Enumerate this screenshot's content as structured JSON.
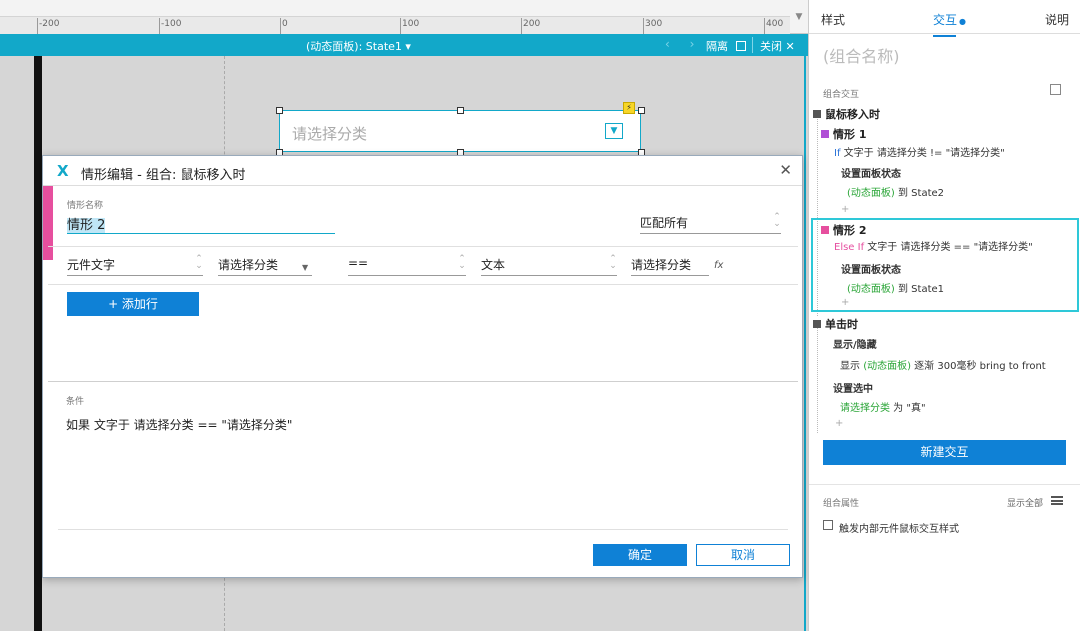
{
  "ruler": {
    "ticks": [
      "-200",
      "-100",
      "0",
      "100",
      "200",
      "300",
      "400"
    ]
  },
  "panel_bar": {
    "state_selector": "(动态面板): State1 ▾",
    "isolate_label": "隔离",
    "close_label": "关闭 ✕",
    "nav_arrows": "‹ ›"
  },
  "canvas_widget": {
    "placeholder": "请选择分类",
    "arrow_icon": "chevron-down-icon"
  },
  "dialog": {
    "logo": "X",
    "title": "情形编辑  -  组合: 鼠标移入时",
    "close_icon": "✕",
    "case_name_label": "情形名称",
    "case_name_value": "情形 2",
    "match_select": "匹配所有",
    "condition_row": {
      "field1": "元件文字",
      "field2": "请选择分类",
      "operator": "==",
      "field4": "文本",
      "field5": "请选择分类",
      "fx": "fx"
    },
    "add_row_button": "+ 添加行",
    "condition_label": "条件",
    "condition_text": "如果 文字于 请选择分类 == \"请选择分类\"",
    "ok_button": "确定",
    "cancel_button": "取消"
  },
  "right_panel": {
    "tabs": [
      "样式",
      "交互",
      "说明"
    ],
    "active_tab_dot": "●",
    "group_name_placeholder": "(组合名称)",
    "group_interactions_label": "组合交互",
    "event_mouse_enter": "鼠标移入时",
    "case1": {
      "label": "情形 1",
      "condition_kw": "If",
      "condition_text": " 文字于 请选择分类 != \"请选择分类\"",
      "action": "设置面板状态",
      "target": "(动态面板)",
      "target_rest": " 到 State2"
    },
    "case2": {
      "label": "情形 2",
      "condition_kw": "Else If",
      "condition_text": " 文字于 请选择分类 == \"请选择分类\"",
      "action": "设置面板状态",
      "target": "(动态面板)",
      "target_rest": " 到 State1"
    },
    "event_click": "单击时",
    "click_action1": "显示/隐藏",
    "click_action1_detail_pre": "显示 ",
    "click_action1_target": "(动态面板)",
    "click_action1_detail_post": " 逐渐 300毫秒 bring to front",
    "click_action2": "设置选中",
    "click_action2_target": "请选择分类",
    "click_action2_detail": " 为 \"真\"",
    "plus": "+",
    "new_interaction_button": "新建交互",
    "group_properties_label": "组合属性",
    "show_all": "显示全部",
    "checkbox_label": "触发内部元件鼠标交互样式"
  },
  "colors": {
    "accent": "#12a8c9",
    "primary_button": "#0f81d6",
    "case_pink": "#e64f9e",
    "condition_blue": "#2b73d8",
    "target_green": "#2aa537",
    "case_purple": "#b04fd6"
  }
}
